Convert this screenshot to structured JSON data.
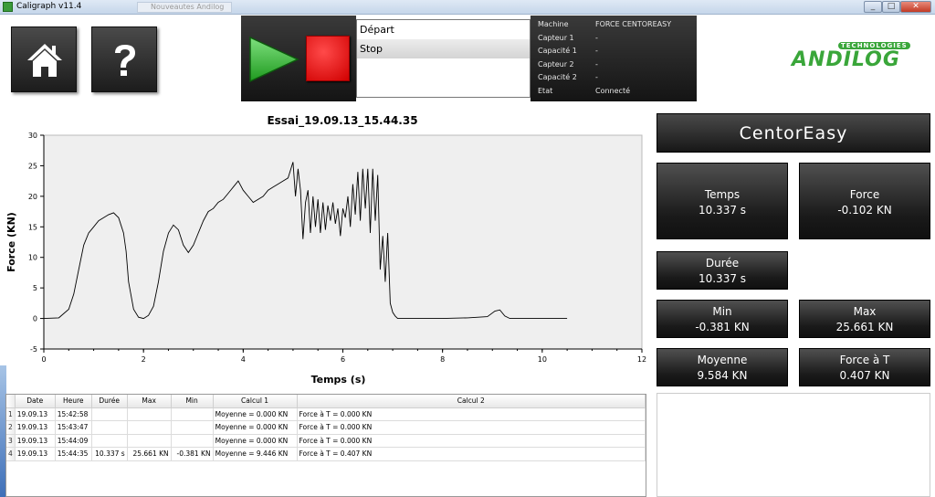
{
  "window": {
    "title": "Caligraph v11.4",
    "ghost_tab": "Nouveautes Andilog",
    "min_label": "_",
    "max_label": "□",
    "close_label": "✕"
  },
  "toolbar": {
    "home_icon": "home-icon",
    "help_icon": "question-icon",
    "play_icon": "play-icon",
    "stop_icon": "stop-icon"
  },
  "menu": {
    "items": [
      {
        "label": "Départ",
        "selected": false
      },
      {
        "label": "Stop",
        "selected": true
      }
    ]
  },
  "machine_info": [
    {
      "key": "Machine",
      "value": "FORCE CENTOREASY"
    },
    {
      "key": "Capteur 1",
      "value": "-"
    },
    {
      "key": "Capacité 1",
      "value": "-"
    },
    {
      "key": "Capteur 2",
      "value": "-"
    },
    {
      "key": "Capacité 2",
      "value": "-"
    },
    {
      "key": "Etat",
      "value": "Connecté"
    }
  ],
  "logo": {
    "tagline": "TECHNOLOGIES",
    "brand": "ANDILOG",
    "brand_color": "#3aa63a"
  },
  "chart_data": {
    "type": "line",
    "title": "Essai_19.09.13_15.44.35",
    "xlabel": "Temps (s)",
    "ylabel": "Force (KN)",
    "xlim": [
      0,
      12
    ],
    "ylim": [
      -5,
      30
    ],
    "x_ticks": [
      0,
      2,
      4,
      6,
      8,
      10,
      12
    ],
    "y_ticks": [
      -5,
      0,
      5,
      10,
      15,
      20,
      25,
      30
    ],
    "grid": false,
    "series": [
      {
        "line_color": "#000000",
        "x": [
          0,
          0.3,
          0.5,
          0.6,
          0.7,
          0.8,
          0.9,
          1.0,
          1.1,
          1.2,
          1.3,
          1.4,
          1.5,
          1.6,
          1.65,
          1.7,
          1.8,
          1.9,
          2.0,
          2.1,
          2.2,
          2.3,
          2.4,
          2.5,
          2.6,
          2.7,
          2.8,
          2.9,
          3.0,
          3.1,
          3.2,
          3.3,
          3.4,
          3.5,
          3.6,
          3.7,
          3.8,
          3.9,
          4.0,
          4.1,
          4.2,
          4.3,
          4.4,
          4.5,
          4.6,
          4.7,
          4.8,
          4.9,
          5.0,
          5.05,
          5.1,
          5.15,
          5.2,
          5.25,
          5.3,
          5.35,
          5.4,
          5.45,
          5.5,
          5.55,
          5.6,
          5.65,
          5.7,
          5.75,
          5.8,
          5.85,
          5.9,
          5.95,
          6.0,
          6.05,
          6.1,
          6.15,
          6.2,
          6.25,
          6.3,
          6.35,
          6.4,
          6.45,
          6.5,
          6.55,
          6.6,
          6.65,
          6.7,
          6.75,
          6.8,
          6.85,
          6.9,
          6.95,
          7.0,
          7.05,
          7.1,
          7.2,
          7.5,
          8.0,
          8.5,
          8.9,
          9.05,
          9.15,
          9.25,
          9.35,
          9.6,
          10.5
        ],
        "y": [
          0,
          0.1,
          1.5,
          4,
          8,
          12,
          14,
          15,
          16,
          16.5,
          17,
          17.3,
          16.5,
          14,
          11,
          6,
          1.5,
          0.2,
          0,
          0.5,
          2,
          6,
          11,
          14,
          15.3,
          14.5,
          12,
          10.8,
          12,
          14,
          16,
          17.5,
          18,
          19,
          19.5,
          20.5,
          21.5,
          22.5,
          21,
          20,
          19,
          19.5,
          20,
          21,
          21.5,
          22,
          22.5,
          23,
          25.6,
          20,
          24.5,
          21,
          13,
          19,
          21,
          14,
          20,
          15,
          19.5,
          14,
          19,
          14.5,
          18.5,
          16,
          19,
          15.5,
          18,
          13.5,
          18,
          16.5,
          20,
          15,
          22,
          17,
          24,
          16,
          24.5,
          18,
          24.5,
          14,
          24.5,
          16,
          23.5,
          8,
          13.5,
          6,
          14,
          2.5,
          1,
          0.4,
          0,
          0,
          0,
          0,
          0.1,
          0.3,
          1.2,
          1.4,
          0.4,
          0,
          0,
          0
        ]
      }
    ]
  },
  "right_panel": {
    "model": "CentorEasy",
    "stats": [
      {
        "label": "Temps",
        "value": "10.337 s"
      },
      {
        "label": "Force",
        "value": "-0.102 KN"
      },
      {
        "label": "Durée",
        "value": "10.337 s"
      },
      {
        "label": "Min",
        "value": "-0.381 KN"
      },
      {
        "label": "Max",
        "value": "25.661 KN"
      },
      {
        "label": "Moyenne",
        "value": "9.584 KN"
      },
      {
        "label": "Force à T",
        "value": "0.407 KN"
      }
    ]
  },
  "results_table": {
    "columns": [
      "Date",
      "Heure",
      "Durée",
      "Max",
      "Min",
      "Calcul 1",
      "Calcul 2"
    ],
    "rows": [
      {
        "n": "1",
        "date": "19.09.13",
        "heure": "15:42:58",
        "duree": "",
        "max": "",
        "min": "",
        "calcul1": "Moyenne = 0.000 KN",
        "calcul2": "Force à T = 0.000 KN"
      },
      {
        "n": "2",
        "date": "19.09.13",
        "heure": "15:43:47",
        "duree": "",
        "max": "",
        "min": "",
        "calcul1": "Moyenne = 0.000 KN",
        "calcul2": "Force à T = 0.000 KN"
      },
      {
        "n": "3",
        "date": "19.09.13",
        "heure": "15:44:09",
        "duree": "",
        "max": "",
        "min": "",
        "calcul1": "Moyenne = 0.000 KN",
        "calcul2": "Force à T = 0.000 KN"
      },
      {
        "n": "4",
        "date": "19.09.13",
        "heure": "15:44:35",
        "duree": "10.337 s",
        "max": "25.661 KN",
        "min": "-0.381 KN",
        "calcul1": "Moyenne = 9.446 KN",
        "calcul2": "Force à T = 0.407 KN"
      }
    ]
  }
}
